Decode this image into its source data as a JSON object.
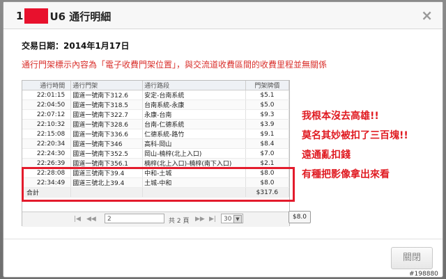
{
  "dialog": {
    "title_prefix": "1",
    "title_suffix": "U6 通行明細",
    "close_symbol": "×",
    "date_line": "交易日期：2014年1月17日",
    "notice": "通行門架標示內容為「電子收費門架位置」，與交流道收費區間的收費里程並無關係",
    "close_button": "關閉"
  },
  "table": {
    "headers": [
      "通行時間",
      "通行門架",
      "通行路段",
      "門架牌價"
    ],
    "rows": [
      [
        "22:01:15",
        "國道一號南下312.6",
        "安定-台南系統",
        "$5.1"
      ],
      [
        "22:04:50",
        "國道一號南下318.5",
        "台南系統-永康",
        "$5.0"
      ],
      [
        "22:07:12",
        "國道一號南下322.7",
        "永康-台南",
        "$9.3"
      ],
      [
        "22:10:32",
        "國道一號南下328.6",
        "台南-仁德系統",
        "$3.9"
      ],
      [
        "22:15:08",
        "國道一號南下336.6",
        "仁德系統-路竹",
        "$9.1"
      ],
      [
        "22:20:34",
        "國道一號南下346",
        "高科-岡山",
        "$8.4"
      ],
      [
        "22:24:30",
        "國道一號南下352.5",
        "岡山-楠梓(北上入口)",
        "$7.0"
      ],
      [
        "22:26:39",
        "國道一號南下356.1",
        "楠梓(北上入口)-楠梓(南下入口)",
        "$2.1"
      ],
      [
        "22:28:08",
        "國道三號南下39.4",
        "中和-土城",
        "$8.0"
      ],
      [
        "22:34:49",
        "國道三號北上39.4",
        "土城-中和",
        "$8.0"
      ]
    ],
    "total_label": "合計",
    "total_value": "$317.6"
  },
  "pager": {
    "first": "|◀",
    "prev": "◀◀",
    "page": "2",
    "page_text": "共 2 頁",
    "next": "▶▶",
    "last": "▶|",
    "page_size": "30"
  },
  "price_chip": "$8.0",
  "annotations": [
    "我根本沒去高雄!!",
    "莫名其妙被扣了三百塊!!",
    "遠通亂扣錢",
    "有種把影像拿出來看"
  ],
  "watermark": "#198880"
}
